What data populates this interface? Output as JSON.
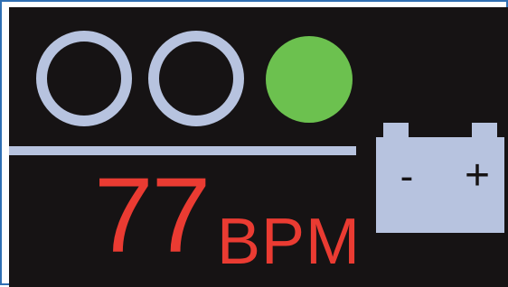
{
  "display": {
    "heart_rate": {
      "value": "77",
      "unit": "BPM",
      "color": "#ea3b32"
    },
    "indicators": [
      {
        "state": "off",
        "color": "#b7c3df"
      },
      {
        "state": "off",
        "color": "#b7c3df"
      },
      {
        "state": "on",
        "color": "#6cc14f"
      }
    ],
    "battery": {
      "icon": "battery-icon",
      "minus_label": "-",
      "plus_label": "+",
      "color": "#b7c3df"
    },
    "background_color": "#161314",
    "border_color": "#2f6fb3"
  }
}
